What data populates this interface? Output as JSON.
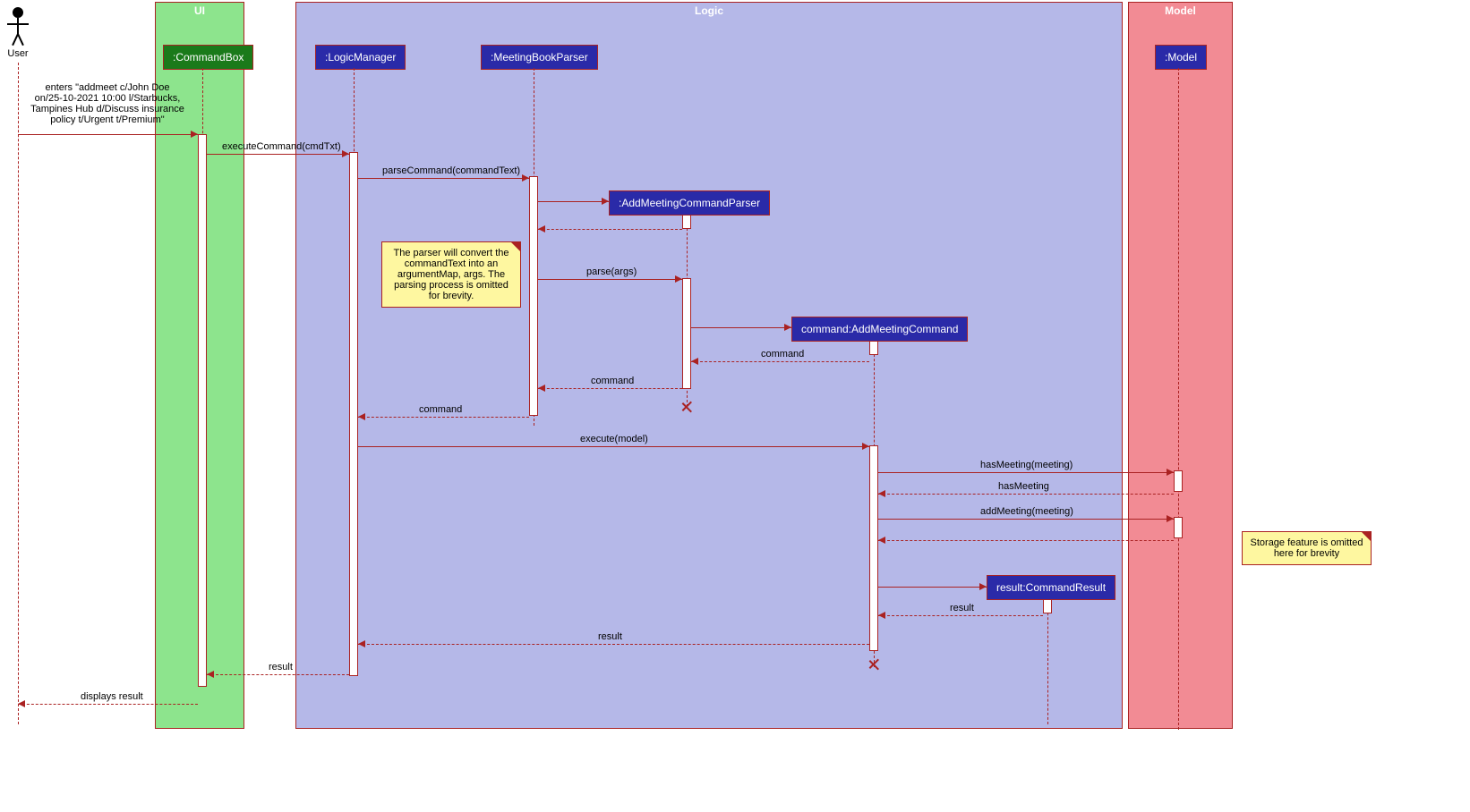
{
  "frames": {
    "ui": "UI",
    "logic": "Logic",
    "model": "Model"
  },
  "actor": {
    "name": "User"
  },
  "participants": {
    "commandBox": ":CommandBox",
    "logicManager": ":LogicManager",
    "meetingBookParser": ":MeetingBookParser",
    "addMeetingCommandParser": ":AddMeetingCommandParser",
    "addMeetingCommand": "command:AddMeetingCommand",
    "model": ":Model",
    "commandResult": "result:CommandResult"
  },
  "messages": {
    "userEntry": "enters \"addmeet c/John Doe\non/25-10-2021 10:00 l/Starbucks,\nTampines Hub d/Discuss insurance\npolicy t/Urgent t/Premium\"",
    "executeCommand": "executeCommand(cmdTxt)",
    "parseCommand": "parseCommand(commandText)",
    "parseArgs": "parse(args)",
    "commandRet1": "command",
    "commandRet2": "command",
    "commandRet3": "command",
    "executeModel": "execute(model)",
    "hasMeeting": "hasMeeting(meeting)",
    "hasMeetingRet": "hasMeeting",
    "addMeeting": "addMeeting(meeting)",
    "resultRet1": "result",
    "resultRet2": "result",
    "resultRet3": "result",
    "displaysResult": "displays result"
  },
  "notes": {
    "parserNote": "The parser will convert the\ncommandText into an\nargumentMap, args. The\nparsing process is omitted\nfor brevity.",
    "storageNote": "Storage feature is omitted\nhere for brevity"
  }
}
